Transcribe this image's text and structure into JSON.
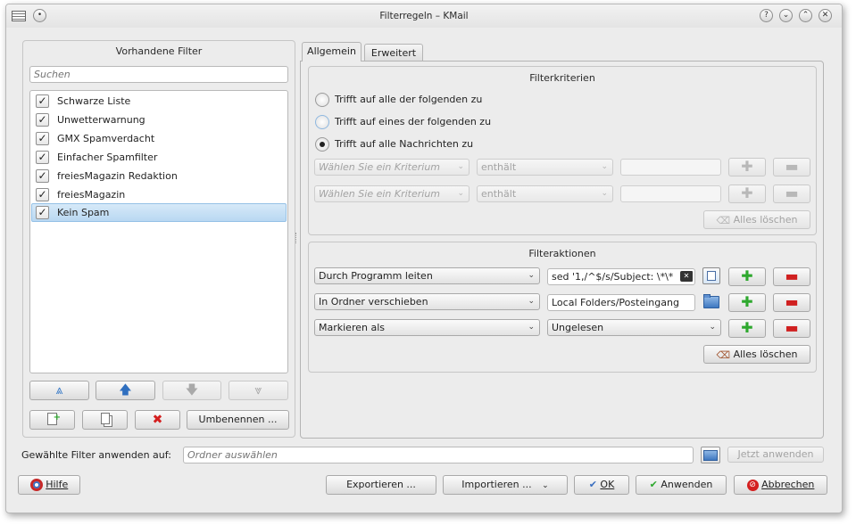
{
  "window": {
    "title": "Filterregeln – KMail",
    "controls": [
      "help-icon",
      "minimize-icon",
      "maximize-icon",
      "close-icon"
    ]
  },
  "left_panel": {
    "title": "Vorhandene Filter",
    "search_placeholder": "Suchen",
    "filters": [
      {
        "label": "Schwarze Liste",
        "checked": true
      },
      {
        "label": "Unwetterwarnung",
        "checked": true
      },
      {
        "label": "GMX Spamverdacht",
        "checked": true
      },
      {
        "label": "Einfacher Spamfilter",
        "checked": true
      },
      {
        "label": "freiesMagazin Redaktion",
        "checked": true
      },
      {
        "label": "freiesMagazin",
        "checked": true
      },
      {
        "label": "Kein Spam",
        "checked": true,
        "selected": true
      }
    ],
    "rename_button": "Umbenennen ..."
  },
  "tabs": [
    {
      "label": "Allgemein",
      "active": true
    },
    {
      "label": "Erweitert",
      "active": false
    }
  ],
  "criteria": {
    "title": "Filterkriterien",
    "radios": [
      {
        "label": "Trifft auf alle der folgenden zu",
        "checked": false
      },
      {
        "label": "Trifft auf eines der folgenden zu",
        "checked": false
      },
      {
        "label": "Trifft auf alle Nachrichten zu",
        "checked": true
      }
    ],
    "rows": [
      {
        "field_placeholder": "Wählen Sie ein Kriterium",
        "operator": "enthält",
        "value": ""
      },
      {
        "field_placeholder": "Wählen Sie ein Kriterium",
        "operator": "enthält",
        "value": ""
      }
    ],
    "clear_button": "Alles löschen"
  },
  "actions": {
    "title": "Filteraktionen",
    "rows": [
      {
        "action": "Durch Programm leiten",
        "value": "sed '1,/^$/s/Subject: \\*\\*"
      },
      {
        "action": "In Ordner verschieben",
        "value": "Local Folders/Posteingang"
      },
      {
        "action": "Markieren als",
        "value": "Ungelesen"
      }
    ],
    "clear_button": "Alles löschen"
  },
  "apply_bar": {
    "label": "Gewählte Filter anwenden auf:",
    "folder_placeholder": "Ordner auswählen",
    "apply_now_button": "Jetzt anwenden"
  },
  "footer": {
    "help": "Hilfe",
    "export": "Exportieren ...",
    "import": "Importieren ...",
    "ok": "OK",
    "apply": "Anwenden",
    "cancel": "Abbrechen"
  },
  "colors": {
    "selection": "#b9d8f2",
    "plus": "#2ea82e",
    "minus": "#d02020"
  }
}
